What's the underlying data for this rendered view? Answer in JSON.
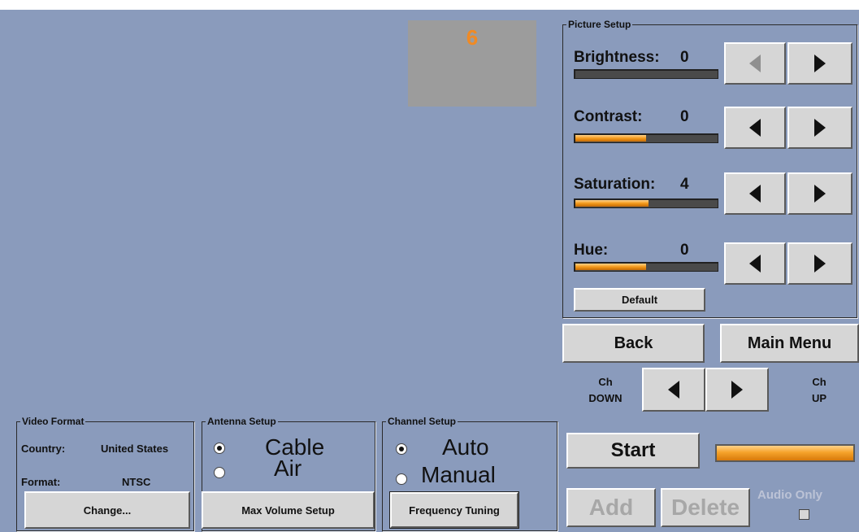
{
  "preview": {
    "channel_number": "6"
  },
  "picture_setup": {
    "legend": "Picture Setup",
    "rows": [
      {
        "label": "Brightness:",
        "value": "0",
        "level": 0.0
      },
      {
        "label": "Contrast:",
        "value": "0",
        "level": 0.5
      },
      {
        "label": "Saturation:",
        "value": "4",
        "level": 0.52
      },
      {
        "label": "Hue:",
        "value": "0",
        "level": 0.5
      }
    ],
    "default_label": "Default"
  },
  "nav": {
    "back_label": "Back",
    "main_menu_label": "Main Menu"
  },
  "channel_nav": {
    "down_line1": "Ch",
    "down_line2": "DOWN",
    "up_line1": "Ch",
    "up_line2": "UP"
  },
  "video_format": {
    "legend": "Video Format",
    "country_label": "Country:",
    "country_value": "United States",
    "format_label": "Format:",
    "format_value": "NTSC",
    "change_label": "Change..."
  },
  "antenna_setup": {
    "legend": "Antenna Setup",
    "option_cable": "Cable",
    "option_air": "Air",
    "selected": "Cable",
    "max_volume_label": "Max Volume Setup"
  },
  "channel_setup": {
    "legend": "Channel Setup",
    "option_auto": "Auto",
    "option_manual": "Manual",
    "selected": "Auto",
    "frequency_label": "Frequency Tuning"
  },
  "scan": {
    "start_label": "Start",
    "progress": 1.0,
    "add_label": "Add",
    "delete_label": "Delete",
    "audio_only_label": "Audio Only",
    "audio_only_checked": false
  },
  "colors": {
    "background": "#8A9BBC",
    "accent": "#F39A1C",
    "button": "#D6D6D6"
  }
}
